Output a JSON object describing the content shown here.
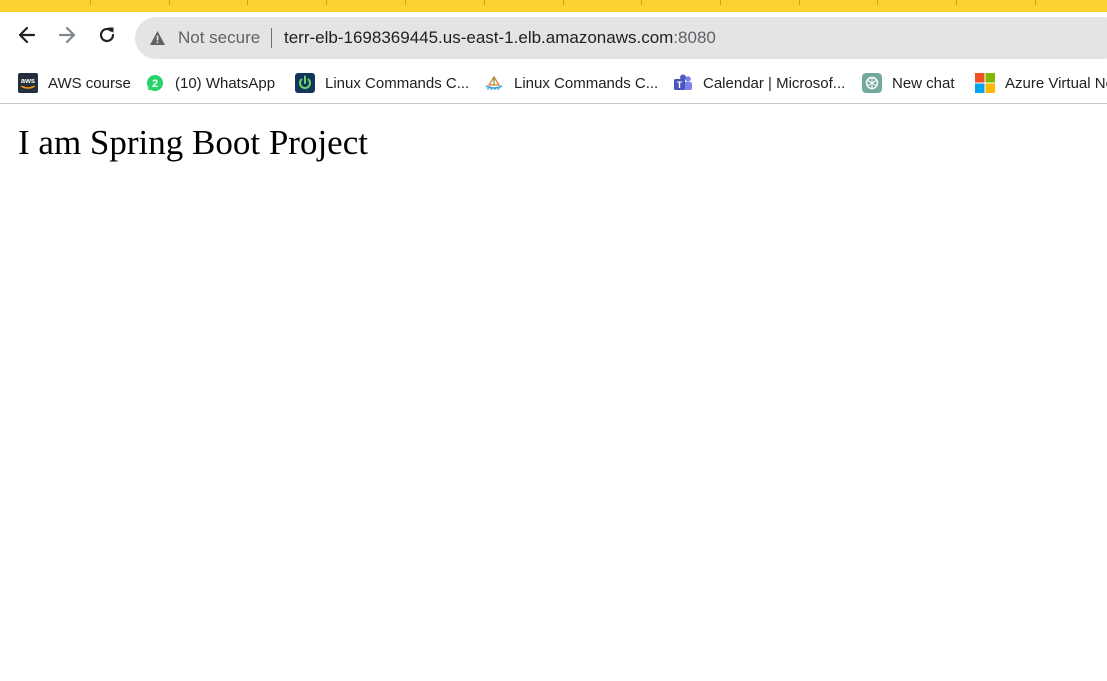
{
  "browser": {
    "accent_color": "#fdd12f",
    "nav": {
      "back_icon": "arrow-left-icon",
      "forward_icon": "arrow-right-icon",
      "reload_icon": "reload-icon"
    },
    "omnibox": {
      "security_icon": "warning-triangle-icon",
      "security_label": "Not secure",
      "host": "terr-elb-1698369445.us-east-1.elb.amazonaws.com",
      "port": ":8080"
    },
    "bookmarks": [
      {
        "label": "AWS course",
        "icon": "aws-icon"
      },
      {
        "label": "(10) WhatsApp",
        "icon": "whatsapp-icon"
      },
      {
        "label": "Linux Commands C...",
        "icon": "power-icon"
      },
      {
        "label": "Linux Commands C...",
        "icon": "ship-icon"
      },
      {
        "label": "Calendar | Microsof...",
        "icon": "teams-icon"
      },
      {
        "label": "New chat",
        "icon": "chatgpt-icon"
      },
      {
        "label": "Azure Virtual Ne",
        "icon": "microsoft-icon"
      }
    ]
  },
  "page": {
    "heading": "I am Spring Boot Project"
  }
}
